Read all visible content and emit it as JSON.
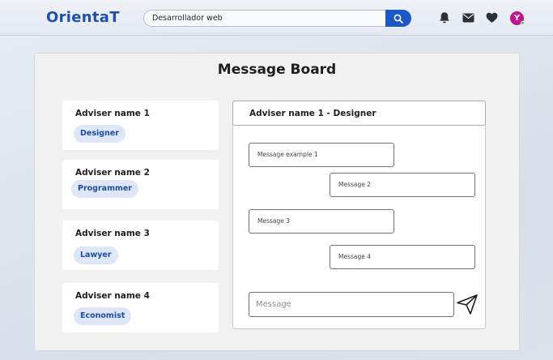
{
  "header": {
    "logo": "OrientaT",
    "search": {
      "value": "Desarrollador web",
      "icon": "search-icon"
    },
    "icons": [
      "bell-icon",
      "mail-icon",
      "heart-icon"
    ],
    "avatar_initial": "Y",
    "colors": {
      "brand": "#1c4fb3",
      "search_button": "#1d58c9",
      "avatar": "#c3158a",
      "online": "#3fc24f"
    }
  },
  "board": {
    "title": "Message Board",
    "advisers": [
      {
        "name": "Adviser name 1",
        "role": "Designer"
      },
      {
        "name": "Adviser name 2",
        "role": "Programmer"
      },
      {
        "name": "Adviser name 3",
        "role": "Lawyer"
      },
      {
        "name": "Adviser name 4",
        "role": "Economist"
      }
    ],
    "chat": {
      "title": "Adviser name 1 - Designer",
      "messages": [
        "Message example 1",
        "Message 2",
        "Message 3",
        "Message 4"
      ],
      "composer_placeholder": "Message",
      "send_icon": "send-icon"
    }
  }
}
